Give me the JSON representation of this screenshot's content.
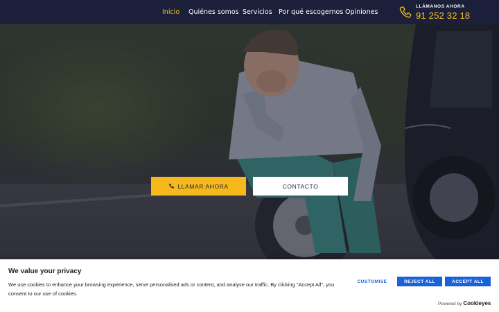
{
  "nav": {
    "items": [
      {
        "label": "Inicio",
        "active": true
      },
      {
        "label": "Quiénes somos",
        "active": false
      },
      {
        "label": "Servicios",
        "active": false
      },
      {
        "label": "Por qué escogernos",
        "active": false
      },
      {
        "label": "Opiniones",
        "active": false
      }
    ]
  },
  "phone": {
    "caption": "LLÁMANOS AHORA",
    "number": "91 252 32 18",
    "icon": "phone-icon"
  },
  "hero": {
    "call_button": "LLAMAR AHORA",
    "contact_button": "CONTACTO"
  },
  "cookie": {
    "title": "We value your privacy",
    "text": "We use cookies to enhance your browsing experience, serve personalised ads or content, and analyse our traffic. By clicking \"Accept All\", you consent to our use of cookies.",
    "customise": "CUSTOMISE",
    "reject": "REJECT ALL",
    "accept": "ACCEPT ALL",
    "powered_by": "Powered by",
    "brand": "Cookieyes"
  },
  "colors": {
    "header_bg": "#1b1f3a",
    "accent": "#f6c21a",
    "cookie_button": "#1863dc"
  }
}
